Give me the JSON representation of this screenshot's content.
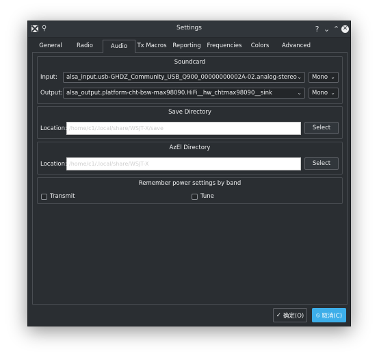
{
  "window": {
    "title": "Settings",
    "help_glyph": "?",
    "minimize_glyph": "⌄",
    "maximize_glyph": "⌃",
    "close_glyph": "✕",
    "pin_glyph": "📌"
  },
  "tabs": [
    {
      "label": "General"
    },
    {
      "label": "Radio"
    },
    {
      "label": "Audio",
      "active": true
    },
    {
      "label": "Tx Macros"
    },
    {
      "label": "Reporting"
    },
    {
      "label": "Frequencies"
    },
    {
      "label": "Colors"
    },
    {
      "label": "Advanced"
    }
  ],
  "soundcard": {
    "title": "Soundcard",
    "input_label": "Input:",
    "input_value": "alsa_input.usb-GHDZ_Community_USB_Q900_00000000002A-02.analog-stereo",
    "input_channel": "Mono",
    "output_label": "Output:",
    "output_value": "alsa_output.platform-cht-bsw-max98090.HiFi__hw_chtmax98090__sink",
    "output_channel": "Mono",
    "chevron_glyph": "⌄"
  },
  "save_directory": {
    "title": "Save Directory",
    "location_label": "Location:",
    "location_value": "/home/c1/.local/share/WSJT-X/save",
    "select_label": "Select"
  },
  "azel_directory": {
    "title": "AzEl Directory",
    "location_label": "Location:",
    "location_value": "/home/c1/.local/share/WSJT-X",
    "select_label": "Select"
  },
  "power": {
    "title": "Remember power settings by band",
    "transmit_label": "Transmit",
    "tune_label": "Tune"
  },
  "dialog_buttons": {
    "ok_label": "确定(O)",
    "ok_glyph": "✓",
    "cancel_label": "取消(C)",
    "cancel_glyph": "⦸"
  },
  "colors": {
    "accent": "#3daee9",
    "window_bg": "#2a2e32",
    "titlebar_bg": "#31363b"
  }
}
